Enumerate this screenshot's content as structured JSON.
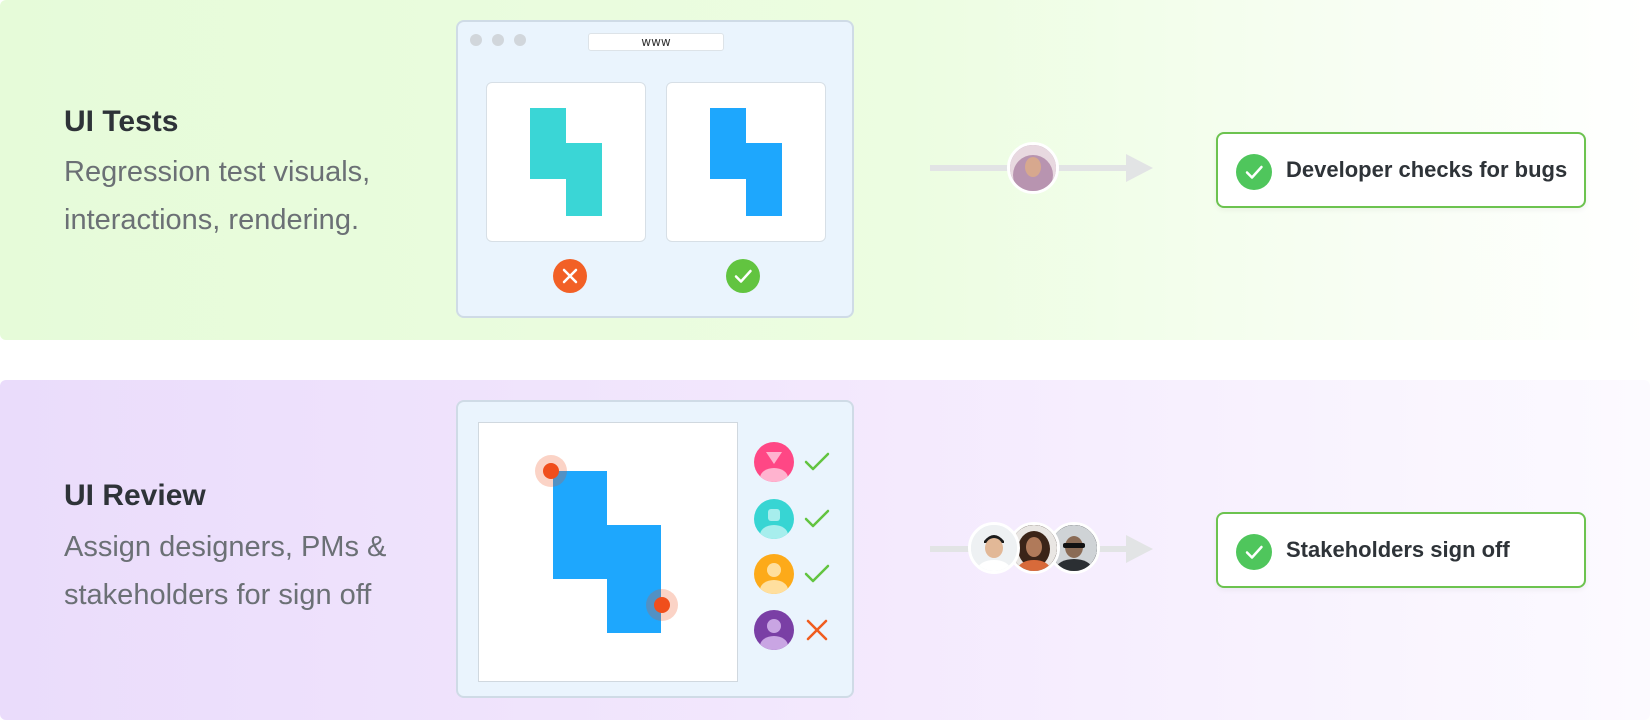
{
  "sections": [
    {
      "title": "UI Tests",
      "description_line1": "Regression test visuals,",
      "description_line2": "interactions, rendering.",
      "browser_url": "www",
      "snapshot_results": [
        "fail",
        "pass"
      ],
      "result_label": "Developer checks for bugs",
      "colors": {
        "snapshot_old": "#3ad6d6",
        "snapshot_new": "#1ea7fd",
        "fail": "#f26026",
        "pass": "#62c440"
      }
    },
    {
      "title": "UI Review",
      "description_line1": "Assign designers, PMs &",
      "description_line2": "stakeholders for sign off",
      "reviewers": [
        {
          "name": "reviewer-1",
          "color": "#ff4785",
          "status": "approved"
        },
        {
          "name": "reviewer-2",
          "color": "#37d5d3",
          "status": "approved"
        },
        {
          "name": "reviewer-3",
          "color": "#fdaa19",
          "status": "approved"
        },
        {
          "name": "reviewer-4",
          "color": "#7a3fa5",
          "status": "rejected"
        }
      ],
      "result_label": "Stakeholders sign off",
      "colors": {
        "component": "#1ea7fd",
        "comment_pin": "#f04e1c",
        "approved": "#62c440",
        "rejected": "#f05c1e"
      }
    }
  ]
}
